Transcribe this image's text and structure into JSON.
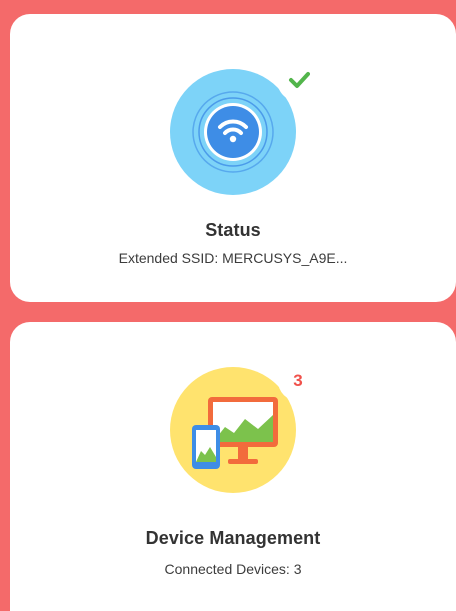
{
  "cards": {
    "status": {
      "title": "Status",
      "subtitle": "Extended SSID: MERCUSYS_A9E...",
      "icon": "wifi-icon",
      "badge_icon": "checkmark-icon",
      "colors": {
        "circle": "#7DD3F8",
        "inner": "#3E8DE6",
        "check": "#52B54B"
      }
    },
    "device_management": {
      "title": "Device Management",
      "subtitle": "Connected Devices: 3",
      "icon": "devices-icon",
      "badge_count": "3",
      "colors": {
        "circle": "#FFE36E",
        "monitor": "#F26B3C",
        "badge": "#F0504A"
      }
    }
  },
  "colors": {
    "background": "#F46A6A",
    "card": "#FFFFFF"
  }
}
